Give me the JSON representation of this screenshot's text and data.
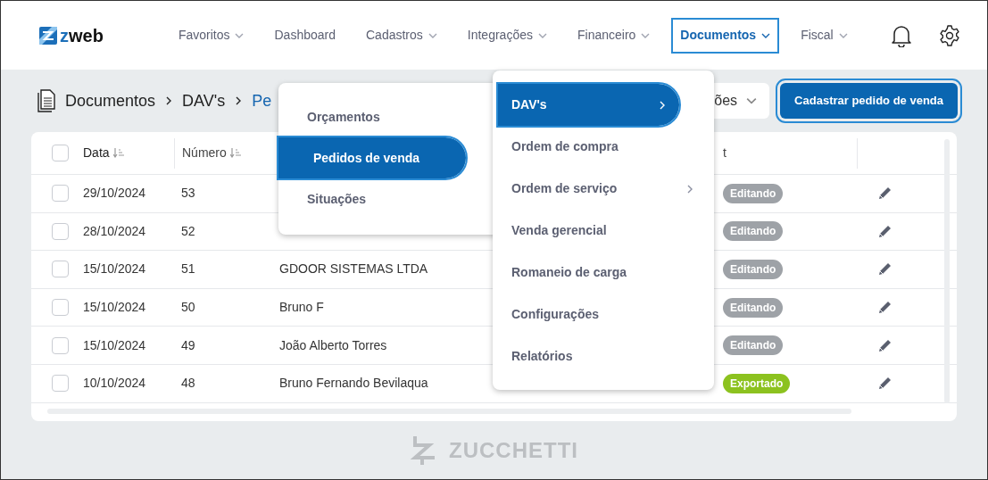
{
  "logo": {
    "text": "zweb"
  },
  "nav": [
    {
      "label": "Favoritos",
      "dropdown": true,
      "selected": false,
      "highlighted": false
    },
    {
      "label": "Dashboard",
      "dropdown": false,
      "selected": false,
      "highlighted": false
    },
    {
      "label": "Cadastros",
      "dropdown": true,
      "selected": false,
      "highlighted": false
    },
    {
      "label": "Integrações",
      "dropdown": true,
      "selected": false,
      "highlighted": false
    },
    {
      "label": "Financeiro",
      "dropdown": true,
      "selected": false,
      "highlighted": false
    },
    {
      "label": "Documentos",
      "dropdown": true,
      "selected": true,
      "highlighted": true
    },
    {
      "label": "Fiscal",
      "dropdown": true,
      "selected": false,
      "highlighted": false
    }
  ],
  "breadcrumb": [
    "Documentos",
    "DAV's",
    "Pe"
  ],
  "filter": {
    "value": "ões"
  },
  "primary_button": {
    "label": "Cadastrar pedido de venda",
    "highlighted": true
  },
  "table": {
    "header_checked": false,
    "columns": [
      {
        "label": "Data",
        "sortable": true
      },
      {
        "label": "Número",
        "sortable": true
      },
      {
        "label": "t",
        "sortable": false
      }
    ],
    "rows": [
      {
        "checked": false,
        "date": "29/10/2024",
        "number": "53",
        "status": {
          "label": "Editando",
          "color": "#9ea2a7"
        }
      },
      {
        "checked": false,
        "date": "28/10/2024",
        "number": "52",
        "status": {
          "label": "Editando",
          "color": "#9ea2a7"
        }
      },
      {
        "checked": false,
        "date": "15/10/2024",
        "number": "51",
        "customer": "GDOOR SISTEMAS LTDA",
        "status": {
          "label": "Editando",
          "color": "#9ea2a7"
        }
      },
      {
        "checked": false,
        "date": "15/10/2024",
        "number": "50",
        "customer": "Bruno F",
        "status": {
          "label": "Editando",
          "color": "#9ea2a7"
        }
      },
      {
        "checked": false,
        "date": "15/10/2024",
        "number": "49",
        "customer": "João Alberto Torres",
        "status": {
          "label": "Editando",
          "color": "#9ea2a7"
        }
      },
      {
        "checked": false,
        "date": "10/10/2024",
        "number": "48",
        "customer": "Bruno Fernando Bevilaqua",
        "status": {
          "label": "Exportado",
          "color": "#8cc21f"
        }
      }
    ]
  },
  "dav_menu": {
    "items": [
      {
        "label": "Orçamentos",
        "selected": false,
        "highlighted": false
      },
      {
        "label": "Pedidos de venda",
        "selected": true,
        "highlighted": true
      },
      {
        "label": "Situações",
        "selected": false,
        "highlighted": false
      }
    ]
  },
  "documentos_menu": {
    "items": [
      {
        "label": "DAV's",
        "submenu": true,
        "selected": true,
        "highlighted": true
      },
      {
        "label": "Ordem de compra",
        "submenu": false,
        "selected": false,
        "highlighted": false
      },
      {
        "label": "Ordem de serviço",
        "submenu": true,
        "selected": false,
        "highlighted": false
      },
      {
        "label": "Venda gerencial",
        "submenu": false,
        "selected": false,
        "highlighted": false
      },
      {
        "label": "Romaneio de carga",
        "submenu": false,
        "selected": false,
        "highlighted": false
      },
      {
        "label": "Configurações",
        "submenu": false,
        "selected": false,
        "highlighted": false
      },
      {
        "label": "Relatórios",
        "submenu": false,
        "selected": false,
        "highlighted": false
      }
    ]
  },
  "footer_logo": {
    "text": "ZUCCHETTI"
  }
}
